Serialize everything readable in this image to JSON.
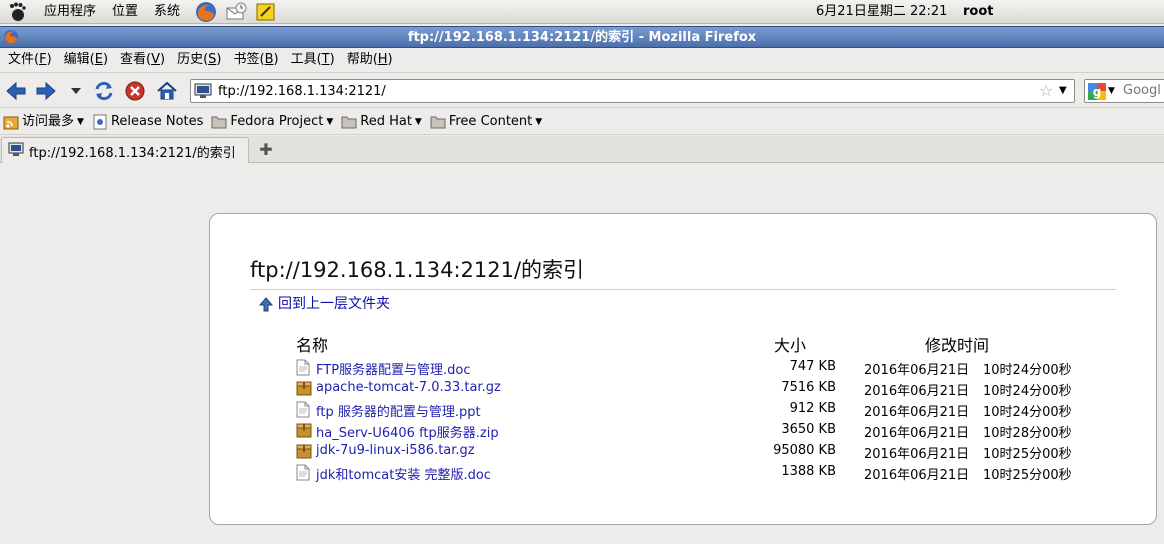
{
  "panel": {
    "menus": [
      "应用程序",
      "位置",
      "系统"
    ],
    "clock": "6月21日星期二 22:21",
    "user": "root"
  },
  "window": {
    "title": "ftp://192.168.1.134:2121/的索引 - Mozilla Firefox"
  },
  "menubar": [
    {
      "text": "文件(",
      "key": "F",
      "end": ")"
    },
    {
      "text": "编辑(",
      "key": "E",
      "end": ")"
    },
    {
      "text": "查看(",
      "key": "V",
      "end": ")"
    },
    {
      "text": "历史(",
      "key": "S",
      "end": ")"
    },
    {
      "text": "书签(",
      "key": "B",
      "end": ")"
    },
    {
      "text": "工具(",
      "key": "T",
      "end": ")"
    },
    {
      "text": "帮助(",
      "key": "H",
      "end": ")"
    }
  ],
  "navbar": {
    "url": "ftp://192.168.1.134:2121/",
    "search_placeholder": "Googl"
  },
  "bookmarks": [
    {
      "label": "访问最多",
      "icon": "rss-folder-icon",
      "dropdown": true
    },
    {
      "label": "Release Notes",
      "icon": "page-icon",
      "dropdown": false
    },
    {
      "label": "Fedora Project",
      "icon": "folder-icon",
      "dropdown": true
    },
    {
      "label": "Red Hat",
      "icon": "folder-icon",
      "dropdown": true
    },
    {
      "label": "Free Content",
      "icon": "folder-icon",
      "dropdown": true
    }
  ],
  "tab": {
    "label": "ftp://192.168.1.134:2121/的索引"
  },
  "listing": {
    "title": "ftp://192.168.1.134:2121/的索引",
    "up_link": "回到上一层文件夹",
    "headers": {
      "name": "名称",
      "size": "大小",
      "modified": "修改时间"
    },
    "files": [
      {
        "name": "FTP服务器配置与管理.doc",
        "size": "747 KB",
        "date": "2016年06月21日",
        "time": "10时24分00秒",
        "type": "document"
      },
      {
        "name": "apache-tomcat-7.0.33.tar.gz",
        "size": "7516 KB",
        "date": "2016年06月21日",
        "time": "10时24分00秒",
        "type": "archive"
      },
      {
        "name": "ftp 服务器的配置与管理.ppt",
        "size": "912 KB",
        "date": "2016年06月21日",
        "time": "10时24分00秒",
        "type": "document"
      },
      {
        "name": "ha_Serv-U6406 ftp服务器.zip",
        "size": "3650 KB",
        "date": "2016年06月21日",
        "time": "10时28分00秒",
        "type": "archive"
      },
      {
        "name": "jdk-7u9-linux-i586.tar.gz",
        "size": "95080 KB",
        "date": "2016年06月21日",
        "time": "10时25分00秒",
        "type": "archive"
      },
      {
        "name": "jdk和tomcat安装 完整版.doc",
        "size": "1388 KB",
        "date": "2016年06月21日",
        "time": "10时25分00秒",
        "type": "document"
      }
    ]
  },
  "colors": {
    "link": "#1f1faf",
    "titlebar": "#5479b6",
    "archive_icon": "#c9902f"
  }
}
